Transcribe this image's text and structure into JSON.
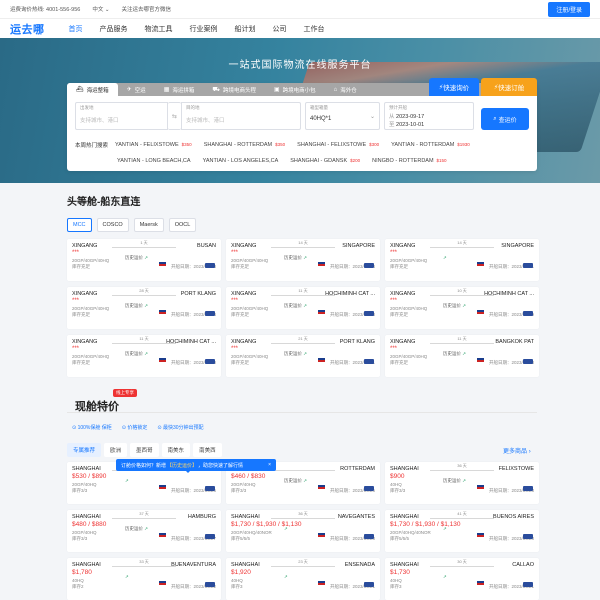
{
  "topbar": {
    "hotline": "运费询价热线: 4001-556-956",
    "lang": "中文",
    "wechat": "关注运去哪官方微信",
    "login": "注册/登录"
  },
  "nav": {
    "logo": "运去哪",
    "items": [
      "首页",
      "产品服务",
      "物流工具",
      "行业案例",
      "船计划",
      "公司",
      "工作台"
    ]
  },
  "hero": {
    "title": "一站式国际物流在线服务平台",
    "tabs": [
      {
        "label": "海运整箱",
        "icon": "ship-icon"
      },
      {
        "label": "空运",
        "icon": "plane-icon"
      },
      {
        "label": "海运拼箱",
        "icon": "box-icon"
      },
      {
        "label": "跨境电商头程",
        "icon": "truck-icon"
      },
      {
        "label": "跨境电商小包",
        "icon": "package-icon"
      },
      {
        "label": "海外仓",
        "icon": "warehouse-icon"
      }
    ],
    "quick_inquiry": "快速询价",
    "quick_booking": "快速订舱"
  },
  "search": {
    "origin_label": "出发地",
    "origin_placeholder": "支持城市、港口",
    "dest_label": "目的地",
    "dest_placeholder": "支持城市、港口",
    "box_label": "箱型箱量",
    "box_value": "40HQ*1",
    "date_label": "预计开船",
    "date_from": "2023-09-17",
    "date_to": "2023-10-01",
    "button": "查运价"
  },
  "hot": {
    "label": "本周热门搜索",
    "routes": [
      {
        "route": "YANTIAN - FELIXSTOWE",
        "price": "$350"
      },
      {
        "route": "SHANGHAI - ROTTERDAM",
        "price": "$350"
      },
      {
        "route": "SHANGHAI - FELIXSTOWE",
        "price": "$300"
      },
      {
        "route": "YANTIAN - ROTTERDAM",
        "price": "$1930"
      },
      {
        "route": "YANTIAN - LONG BEACH,CA",
        "price": ""
      },
      {
        "route": "YANTIAN - LOS ANGELES,CA",
        "price": ""
      },
      {
        "route": "SHANGHAI - GDANSK",
        "price": "$200"
      },
      {
        "route": "NINGBO - ROTTERDAM",
        "price": "$150"
      }
    ]
  },
  "head_section": {
    "title": "头等舱-船东直连",
    "carriers": [
      "MCC",
      "COSCO",
      "Maersk",
      "OOCL"
    ],
    "cards": [
      {
        "from": "XINGANG",
        "to": "BUSAN",
        "days": "1 天",
        "stars": "***",
        "hist": "历史运价",
        "ctype": "20GP/40GP/40HQ",
        "stock": "库存充足",
        "sail": "开船日期：2023/09/18"
      },
      {
        "from": "XINGANG",
        "to": "SINGAPORE",
        "days": "14 天",
        "stars": "***",
        "hist": "历史运价",
        "ctype": "20GP/40GP/40HQ",
        "stock": "库存充足",
        "sail": "开船日期：2023/09/24"
      },
      {
        "from": "XINGANG",
        "to": "SINGAPORE",
        "days": "14 天",
        "stars": "***",
        "hist": "",
        "ctype": "20GP/40GP/40HQ",
        "stock": "库存充足",
        "sail": "开船日期：2023/10/01"
      },
      {
        "from": "XINGANG",
        "to": "PORT KLANG",
        "days": "28 天",
        "stars": "***",
        "hist": "历史运价",
        "ctype": "20GP/40GP/40HQ",
        "stock": "库存充足",
        "sail": "开船日期：2023/09/24"
      },
      {
        "from": "XINGANG",
        "to": "HOCHIMINH CAT ...",
        "days": "11 天",
        "stars": "***",
        "hist": "历史运价",
        "ctype": "20GP/40GP/40HQ",
        "stock": "库存充足",
        "sail": "开船日期：2023/09/23"
      },
      {
        "from": "XINGANG",
        "to": "HOCHIMINH CAT ...",
        "days": "10 天",
        "stars": "***",
        "hist": "历史运价",
        "ctype": "20GP/40GP/40HQ",
        "stock": "库存充足",
        "sail": "开船日期：2023/09/19"
      },
      {
        "from": "XINGANG",
        "to": "HOCHIMINH CAT ...",
        "days": "11 天",
        "stars": "***",
        "hist": "历史运价",
        "ctype": "20GP/40GP/40HQ",
        "stock": "库存充足",
        "sail": "开船日期：2023/09/30"
      },
      {
        "from": "XINGANG",
        "to": "PORT KLANG",
        "days": "21 天",
        "stars": "***",
        "hist": "历史运价",
        "ctype": "20GP/40GP/40HQ",
        "stock": "库存充足",
        "sail": "开船日期：2023/10/01"
      },
      {
        "from": "XINGANG",
        "to": "BANGKOK PAT",
        "days": "11 天",
        "stars": "***",
        "hist": "历史运价",
        "ctype": "20GP/40GP/40HQ",
        "stock": "库存充足",
        "sail": "开船日期：2023/09/23"
      }
    ]
  },
  "spot_section": {
    "title": "现舱特价",
    "badge": "线上专享",
    "features": [
      "100%保舱 保柜",
      "价格锁定",
      "最快30分钟出预配"
    ],
    "regions": [
      "专属推荐",
      "欧洲",
      "墨西哥",
      "南美东",
      "南美西"
    ],
    "more": "更多商品",
    "tooltip_pre": "订舱价格如何？新增",
    "tooltip_hl": "【历史运价】",
    "tooltip_post": "，助您快速了解行情",
    "tooltip_close": "×",
    "cards": [
      {
        "from": "SHANGHAI",
        "to": "",
        "days": "",
        "price": "$530 / $890",
        "hist": "",
        "ctype": "20GP/40HQ",
        "stock": "库存3/3",
        "sail": "开船日期：2023/09/26"
      },
      {
        "from": "",
        "to": "ROTTERDAM",
        "days": "",
        "price": "$460 / $830",
        "hist": "历史运价",
        "ctype": "20GP/40HQ",
        "stock": "库存3/3",
        "sail": "开船日期：2023/09/26"
      },
      {
        "from": "SHANGHAI",
        "to": "FELIXSTOWE",
        "days": "36 天",
        "price": "$900",
        "hist": "历史运价",
        "ctype": "40HQ",
        "stock": "库存3/3",
        "sail": "开船日期：2023/09/23"
      },
      {
        "from": "SHANGHAI",
        "to": "HAMBURG",
        "days": "37 天",
        "price": "$480 / $880",
        "hist": "历史运价",
        "ctype": "20GP/40HQ",
        "stock": "库存3/3",
        "sail": "开船日期：2023/09/27"
      },
      {
        "from": "SHANGHAI",
        "to": "NAVEGANTES",
        "days": "36 天",
        "price": "$1,730 / $1,930 / $1,130",
        "hist": "",
        "ctype": "20GP/40HQ/40NOR",
        "stock": "库存5/5/5",
        "sail": "开船日期：2023/09/23"
      },
      {
        "from": "SHANGHAI",
        "to": "BUENOS AIRES",
        "days": "41 天",
        "price": "$1,730 / $1,930 / $1,130",
        "hist": "",
        "ctype": "20GP/40HQ/40NOR",
        "stock": "库存5/5/5",
        "sail": "开船日期：2023/09/23"
      },
      {
        "from": "SHANGHAI",
        "to": "BUENAVENTURA",
        "days": "33 天",
        "price": "$1,780",
        "hist": "",
        "ctype": "40HQ",
        "stock": "库存2",
        "sail": "开船日期：2023/09/22"
      },
      {
        "from": "SHANGHAI",
        "to": "ENSENADA",
        "days": "23 天",
        "price": "$1,920",
        "hist": "",
        "ctype": "40HQ",
        "stock": "库存3",
        "sail": "开船日期：2023/09/21"
      },
      {
        "from": "SHANGHAI",
        "to": "CALLAO",
        "days": "30 天",
        "price": "$1,730",
        "hist": "",
        "ctype": "40HQ",
        "stock": "库存3",
        "sail": "开船日期：2023/09/21"
      }
    ]
  }
}
